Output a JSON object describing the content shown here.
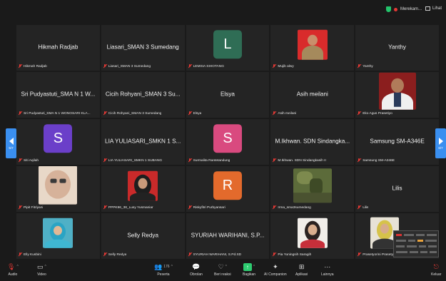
{
  "topbar": {
    "recording_text": "Merekam...",
    "view_text": "Lihat"
  },
  "navigation": {
    "left_page": "5/7",
    "right_page": "6/7"
  },
  "tiles": [
    {
      "name": "Hikmah Radjab",
      "label": "Hikmah Radjab"
    },
    {
      "name": "Liasari_SMAN 3 Sumedang",
      "label": "Liasari_SMAN 3 Sumedang"
    },
    {
      "avatar_letter": "L",
      "avatar_color": "#2f6d55",
      "label": "LEMSIA SIHOTANG"
    },
    {
      "label": "Mujib alwy"
    },
    {
      "name": "Yanthy",
      "label": "Yanthy"
    },
    {
      "name": "Sri Pudyastuti_SMA N 1 W...",
      "label": "Sri Pudyastuti_SMA N 1 WONOSARI KLA..."
    },
    {
      "name": "Cicih Rohyani_SMAN 3 Su...",
      "label": "Cicih Rohyani_SMAN 3 Sumedang"
    },
    {
      "name": "Elsya",
      "label": "Elsya"
    },
    {
      "name": "Asih meilani",
      "label": "Asih meilani"
    },
    {
      "label": "Eko Agus Prasetiyo"
    },
    {
      "avatar_letter": "S",
      "avatar_color": "#6b3fc9",
      "label": "Siti Aqilah"
    },
    {
      "name": "LIA YULIASARI_SMKN 1 S...",
      "label": "LIA YULIASARI_SMKN 1 SUBANG"
    },
    {
      "avatar_letter": "S",
      "avatar_color": "#d94a7f",
      "label": "Surmalita Rantetandung"
    },
    {
      "name": "M.Ikhwan. SDN Sindangka...",
      "label": "M.Ikhwan. SDN Sindangkasih II"
    },
    {
      "name": "Samsung SM-A346E",
      "label": "Samsung SM-A346E"
    },
    {
      "label": "Pipit Fitriyani"
    },
    {
      "label": "PPPK96_38_Lusy Yusmaniar"
    },
    {
      "avatar_letter": "R",
      "avatar_color": "#e36a2c",
      "label": "Riskyfitri Purbyansari"
    },
    {
      "label": "Irma_sma3sumedang"
    },
    {
      "name": "Lilis",
      "label": "Lilis"
    },
    {
      "label": "Elly Kusbini"
    },
    {
      "name": "Selly Redya",
      "label": "Selly Redya"
    },
    {
      "name": "SYURIAH WARIHANI, S.P...",
      "label": "SYURIAH WARIHANI, S.Pd.SD"
    },
    {
      "label": "Pia Yuningsih Saragih"
    },
    {
      "label": "Prasetyorini Prasetyo"
    }
  ],
  "toolbar": {
    "audio": "Audio",
    "video": "Video",
    "participants": "Peserta",
    "participant_count": "176",
    "chat": "Obrolan",
    "react": "Beri reaksi",
    "share": "Bagikan",
    "ai_companion": "AI Companion",
    "apps": "Aplikasi",
    "more": "Lainnya",
    "leave": "Keluar"
  }
}
